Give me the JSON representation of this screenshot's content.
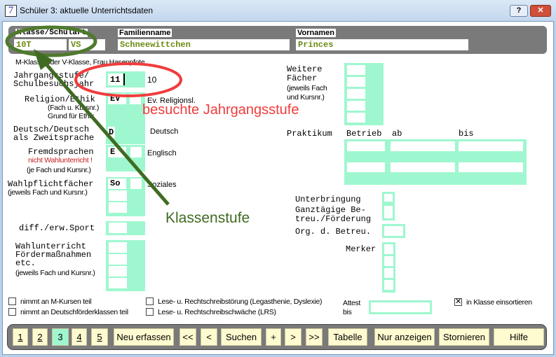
{
  "window": {
    "title": "Schüler 3: aktuelle Unterrichtsdaten",
    "app_icon": "7",
    "help": "?",
    "close": "✕"
  },
  "header": {
    "klasse_label": "Klasse/Schulart",
    "klasse": "10T",
    "schulart": "VS",
    "familienname_label": "Familienname",
    "familienname": "Schneewittchen",
    "vornamen_label": "Vornamen",
    "vornamen": "Princes"
  },
  "info": "M-Klasse oder V-Klasse, Frau Hasenpfote",
  "form": {
    "jahrgang_label": "Jahrgangsstufe/\nSchulbesuchsjahr",
    "jahrgang": "11",
    "schulbesuchsjahr": "10",
    "religion_label": "Religion/Ethik",
    "religion_sub1": "(Fach u. Kursnr.)",
    "religion_sub2": "Grund für Ethik",
    "religion": "EV",
    "religion_text": "Ev. Religionsl.",
    "deutsch_label": "Deutsch/Deutsch\nals Zweitsprache",
    "deutsch": "D",
    "deutsch_text": "Deutsch",
    "fremd_label": "Fremdsprachen",
    "fremd_warn": "nicht Wahlunterricht !",
    "fremd_sub": "(je Fach und Kursnr.)",
    "fremd": "E",
    "fremd_text": "Englisch",
    "wpf_label": "Wahlpflichtfächer",
    "wpf_sub": "(jeweils Fach und Kursnr.)",
    "wpf": "So",
    "wpf_text": "Soziales",
    "sport_label": "diff./erw.Sport",
    "wahl_label": "Wahlunterricht\nFördermaßnahmen\netc.",
    "wahl_sub": "(jeweils Fach und  Kursnr.)",
    "weitere_label": "Weitere\nFächer",
    "weitere_sub": "(jeweils Fach\nund Kursnr.)",
    "praktikum_label": "Praktikum",
    "betrieb": "Betrieb",
    "ab": "ab",
    "bis": "bis",
    "unterbringung": "Unterbringung",
    "ganztag": "Ganztägige Be-\ntreu./Förderung",
    "org": "Org. d. Betreu.",
    "merker": "Merker",
    "attest": "Attest\nbis"
  },
  "checkboxes": [
    {
      "label": "nimmt an M-Kursen teil",
      "checked": false
    },
    {
      "label": "nimmt an Deutschförderklassen teil",
      "checked": false
    },
    {
      "label": "Lese- u. Rechtschreibstörung (Legasthenie, Dyslexie)",
      "checked": false
    },
    {
      "label": "Lese- u. Rechtschreibschwäche (LRS)",
      "checked": false
    },
    {
      "label": "in Klasse einsortieren",
      "checked": true
    }
  ],
  "toolbar": [
    "1",
    "2",
    "3",
    "4",
    "5",
    "Neu erfassen",
    "<<",
    "<",
    "Suchen",
    "+",
    ">",
    ">>",
    "Tabelle",
    "Nur anzeigen",
    "Stornieren",
    "Hilfe"
  ],
  "active_page": "3",
  "annotations": {
    "red_text": "besuchte Jahrgangsstufe",
    "green_text": "Klassenstufe",
    "red": "#f03c3c",
    "green": "#3f6b22"
  }
}
